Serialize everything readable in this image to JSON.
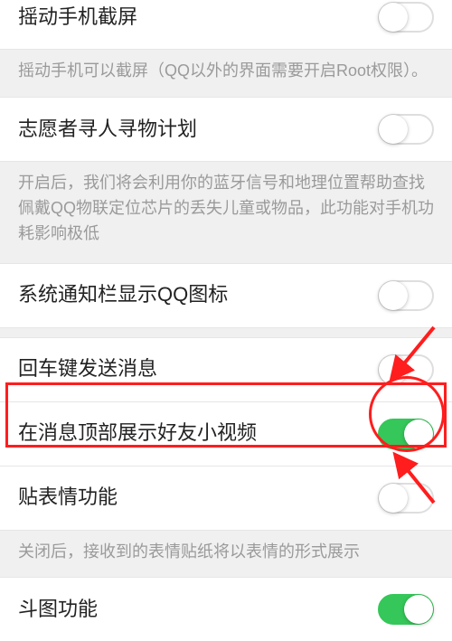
{
  "rows": [
    {
      "id": "shake-screenshot",
      "title": "摇动手机截屏",
      "on": false,
      "desc": "摇动手机可以截屏（QQ以外的界面需要开启Root权限）。"
    },
    {
      "id": "volunteer-plan",
      "title": "志愿者寻人寻物计划",
      "on": false,
      "desc": "开启后，我们将会利用你的蓝牙信号和地理位置帮助查找佩戴QQ物联定位芯片的丢失儿童或物品，此功能对手机功耗影响极低"
    },
    {
      "id": "show-qq-icon",
      "title": "系统通知栏显示QQ图标",
      "on": false,
      "desc": null
    },
    {
      "id": "enter-send",
      "title": "回车键发送消息",
      "on": false,
      "desc": null
    },
    {
      "id": "friend-short-video",
      "title": "在消息顶部展示好友小视频",
      "on": true,
      "desc": null
    },
    {
      "id": "sticker-feature",
      "title": "贴表情功能",
      "on": false,
      "desc": "关闭后，接收到的表情贴纸将以表情的形式展示"
    },
    {
      "id": "doutu",
      "title": "斗图功能",
      "on": true,
      "desc": null
    }
  ],
  "annotation": {
    "highlight_row_id": "friend-short-video",
    "color": "#ff1d1d"
  }
}
